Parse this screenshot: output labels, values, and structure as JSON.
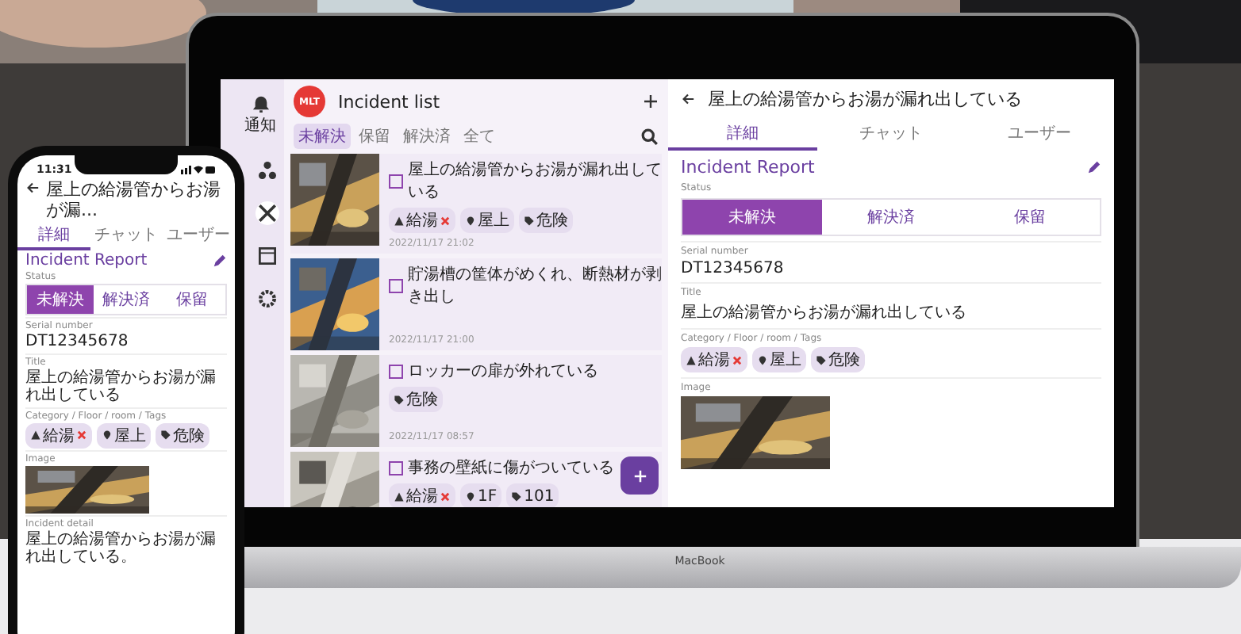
{
  "laptop": {
    "brand": "MacBook",
    "nav": [
      {
        "label": "通知",
        "selected": false
      },
      {
        "selected": false
      },
      {
        "selected": true
      },
      {
        "selected": false
      },
      {
        "selected": false
      }
    ],
    "list": {
      "avatar": "MLT",
      "title": "Incident list",
      "filters": [
        {
          "label": "未解決",
          "selected": true
        },
        {
          "label": "保留",
          "selected": false
        },
        {
          "label": "解決済",
          "selected": false
        },
        {
          "label": "全て",
          "selected": false
        }
      ],
      "cards": [
        {
          "title": "屋上の給湯管からお湯が漏れ出している",
          "checked": false,
          "tags": [
            {
              "kind": "category",
              "label": "給湯"
            },
            {
              "kind": "location",
              "label": "屋上"
            },
            {
              "kind": "tag",
              "label": "危険"
            }
          ],
          "date": "2022/11/17 21:02"
        },
        {
          "title": "貯湯槽の筐体がめくれ、断熱材が剥き出し",
          "checked": false,
          "date": "2022/11/17 21:00"
        },
        {
          "title": "ロッカーの扉が外れている",
          "checked": false,
          "tags": [
            {
              "kind": "tag",
              "label": "危険"
            }
          ],
          "date": "2022/11/17 08:57"
        },
        {
          "title": "事務の壁紙に傷がついている",
          "checked": false,
          "tags": [
            {
              "kind": "category",
              "label": "給湯"
            },
            {
              "kind": "location",
              "label": "1F"
            },
            {
              "kind": "tag",
              "label": "101"
            }
          ]
        }
      ]
    },
    "detail": {
      "title": "屋上の給湯管からお湯が漏れ出している",
      "tabs": [
        {
          "label": "詳細",
          "selected": true
        },
        {
          "label": "チャット",
          "selected": false
        },
        {
          "label": "ユーザー",
          "selected": false
        }
      ],
      "heading": "Incident Report",
      "status_label": "Status",
      "statuses": [
        {
          "label": "未解決",
          "selected": true
        },
        {
          "label": "解決済",
          "selected": false
        },
        {
          "label": "保留",
          "selected": false
        }
      ],
      "fields": [
        {
          "kind": "text",
          "label": "Serial number",
          "value": "DT12345678"
        },
        {
          "kind": "text",
          "label": "Title",
          "value": "屋上の給湯管からお湯が漏れ出している"
        },
        {
          "kind": "tags",
          "label": "Category / Floor / room / Tags",
          "tags": [
            {
              "kind": "category",
              "label": "給湯"
            },
            {
              "kind": "location",
              "label": "屋上"
            },
            {
              "kind": "tag",
              "label": "危険"
            }
          ]
        },
        {
          "label": "Image"
        }
      ]
    }
  },
  "phone": {
    "time": "11:31",
    "detail": {
      "title": "屋上の給湯管からお湯が漏...",
      "tabs": [
        {
          "label": "詳細",
          "selected": true
        },
        {
          "label": "チャット",
          "selected": false
        },
        {
          "label": "ユーザー",
          "selected": false
        }
      ],
      "heading": "Incident Report",
      "status_label": "Status",
      "statuses": [
        {
          "label": "未解決",
          "selected": true
        },
        {
          "label": "解決済",
          "selected": false
        },
        {
          "label": "保留",
          "selected": false
        }
      ],
      "fields": [
        {
          "kind": "text",
          "label": "Serial number",
          "value": "DT12345678"
        },
        {
          "kind": "text",
          "label": "Title",
          "value": "屋上の給湯管からお湯が漏れ出している"
        },
        {
          "kind": "tags",
          "label": "Category / Floor / room / Tags",
          "tags": [
            {
              "kind": "category",
              "label": "給湯"
            },
            {
              "kind": "location",
              "label": "屋上"
            },
            {
              "kind": "tag",
              "label": "危険"
            }
          ]
        },
        {
          "label": "Image"
        },
        {
          "kind": "text",
          "label": "Incident detail",
          "value": "屋上の給湯管からお湯が漏れ出している。"
        }
      ]
    }
  }
}
